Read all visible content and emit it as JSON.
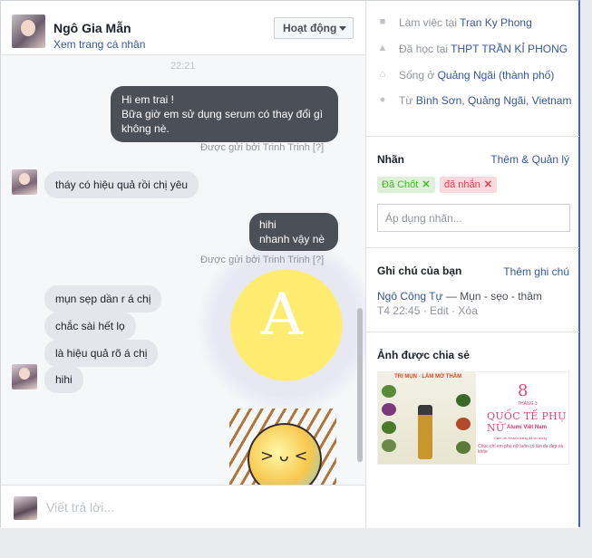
{
  "chat": {
    "contact_name": "Ngô Gia Mẫn",
    "profile_link": "Xem trang cá nhân",
    "status_button": "Hoạt động",
    "time_divider": "22:21",
    "messages": [
      {
        "text": "Hi em trai !\nBữa giờ em sử dụng serum có thay đổi gì không nè."
      },
      {
        "sent_by": "Được gửi bởi Trinh Trinh",
        "sent_by_q": "[?]"
      },
      {
        "text": "tháy có hiệu quả rồi chị yêu"
      },
      {
        "text": "hihi\nnhanh vậy nè"
      },
      {
        "sent_by": "Được gửi bởi Trinh Trinh",
        "sent_by_q": "[?]"
      },
      {
        "text": "mụn sẹp dần r á chị"
      },
      {
        "text": "chắc sài hết lọ"
      },
      {
        "text": "là hiệu quả rõ á chị"
      },
      {
        "text": "hihi"
      }
    ],
    "watermark_letter": "A",
    "composer_placeholder": "Viết trả lời...",
    "composer_icons": [
      "attachment-icon",
      "emoji-icon",
      "saved-reply-icon",
      "like-icon"
    ]
  },
  "info": {
    "work_prefix": "Làm việc tại",
    "work_link": "Tran Ky Phong",
    "study_prefix": "Đã học tại",
    "study_link": "THPT TRẦN KỈ PHONG",
    "lives_prefix": "Sống ở",
    "lives_link": "Quảng Ngãi (thành phố)",
    "from_prefix": "Từ",
    "from_link": "Bình Sơn, Quảng Ngãi, Vietnam",
    "labels_title": "Nhãn",
    "labels_action": "Thêm & Quản lý",
    "tags": [
      {
        "label": "Đã Chốt",
        "bg": "#dff0d8",
        "color": "#42b72a"
      },
      {
        "label": "đã nhắn",
        "bg": "#fbd9dc",
        "color": "#e03e52"
      }
    ],
    "label_placeholder": "Áp dụng nhãn...",
    "notes_title": "Ghi chú của bạn",
    "notes_action": "Thêm ghi chú",
    "note_author": "Ngô Công Tự",
    "note_text": "— Mụn - sẹo - thâm",
    "note_meta_time": "T4 22:45",
    "note_edit": "Edit",
    "note_delete": "Xóa",
    "shared_title": "Ảnh được chia sẻ",
    "shared_image": {
      "left_title": "TRỊ MỤN - LÀM MỜ THÂM",
      "big_number": "8",
      "month": "THÁNG 3",
      "headline": "QUỐC TẾ PHỤ NỮ",
      "brand": "Alumi Việt Nam",
      "small_line1": "Cảm ơn Khách hàng đã tin dùng",
      "small_line2": "Chúc chị em phụ nữ luôn có làn da đẹp và khỏe"
    }
  },
  "colors": {
    "accent": "#4267b2",
    "link": "#365899",
    "bubble_me": "#4b4f56",
    "bubble_them": "#e4e6eb"
  }
}
